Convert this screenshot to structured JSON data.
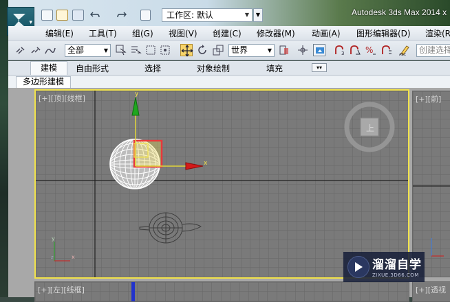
{
  "window": {
    "title": "Autodesk 3ds Max  2014 x",
    "workspace_label": "工作区: 默认"
  },
  "menu": {
    "items": [
      "编辑(E)",
      "工具(T)",
      "组(G)",
      "视图(V)",
      "创建(C)",
      "修改器(M)",
      "动画(A)",
      "图形编辑器(D)",
      "渲染(R"
    ]
  },
  "toolbar": {
    "selection_filter": "全部",
    "reference_coord": "世界",
    "named_selection_placeholder": "创建选择"
  },
  "ribbon": {
    "tabs": [
      "建模",
      "自由形式",
      "选择",
      "对象绘制",
      "填充"
    ],
    "active_tab": "建模",
    "panel_tab": "多边形建模"
  },
  "viewports": {
    "top_label": "[+][顶][线框]",
    "front_label": "[+][前]",
    "left_label": "[+][左][线框]",
    "persp_label": "[+][透视"
  },
  "gizmo": {
    "x_axis": "x",
    "y_axis": "y"
  },
  "viewcube_face": "上",
  "watermark": {
    "brand": "溜溜自学",
    "url": "ZIXUE.3D66.COM"
  },
  "colors": {
    "active_viewport_border": "#f1e24a",
    "viewport_bg": "#7a7a7a",
    "gizmo_x": "#d41a1a",
    "gizmo_y": "#1fa71f",
    "selection_box": "#e8393b"
  }
}
